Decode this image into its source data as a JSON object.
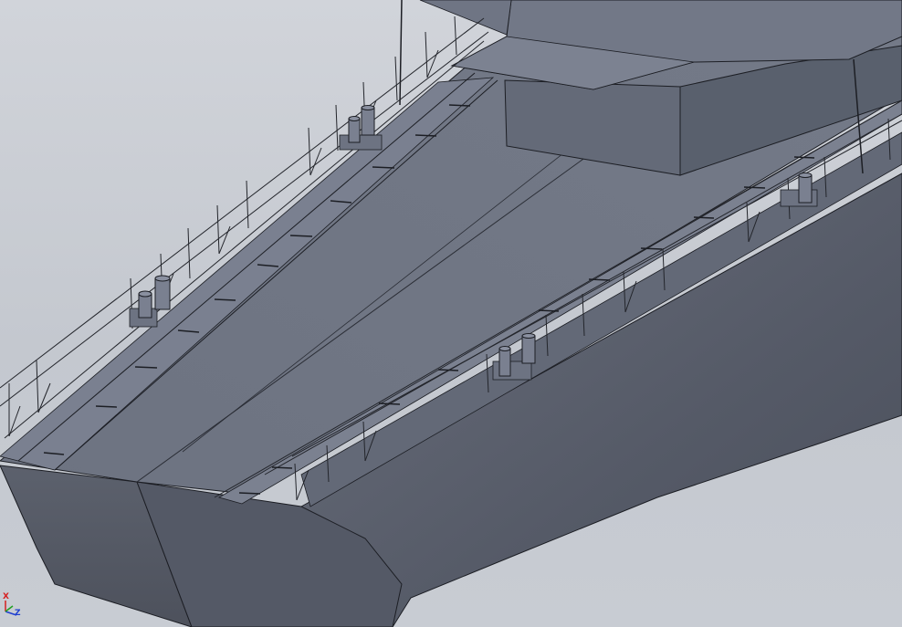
{
  "viewport": {
    "background": "#c6cad1",
    "model": {
      "hull_color": "#5a5f6c",
      "deck_color": "#6b7180",
      "edge_color": "#1c1e24",
      "rail_color": "#23252b"
    }
  },
  "triad": {
    "x_label": "X",
    "z_label": "Z",
    "x_color": "#d62020",
    "z_color": "#2040d0"
  }
}
